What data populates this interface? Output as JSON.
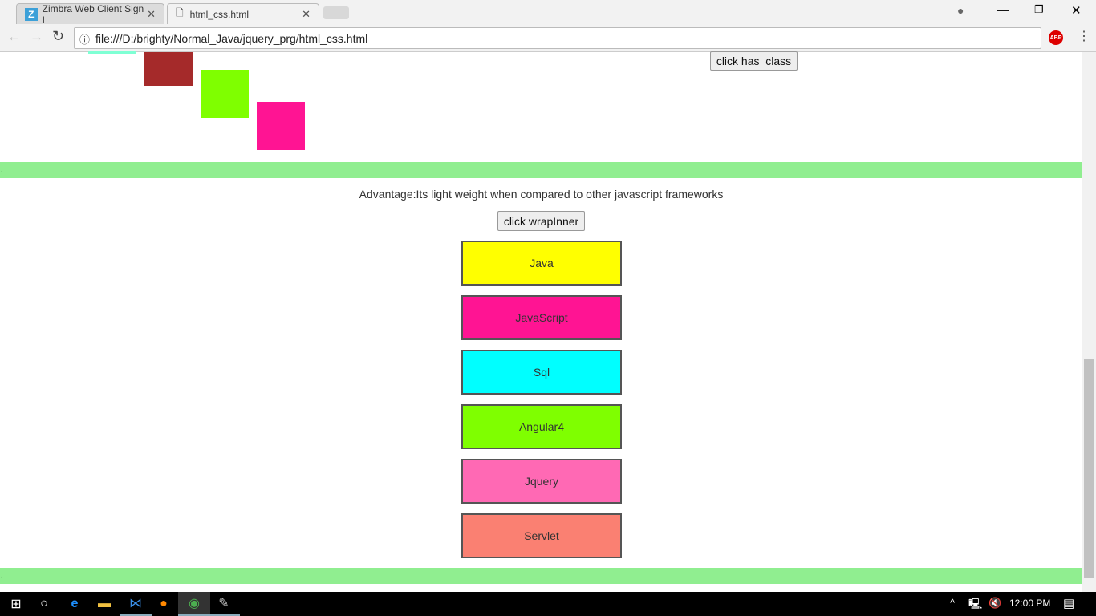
{
  "browser": {
    "tabs": [
      {
        "label": "Zimbra Web Client Sign I",
        "icon": "zimbra-icon",
        "active": false
      },
      {
        "label": "html_css.html",
        "icon": "file-icon",
        "active": true
      }
    ],
    "url": "file:///D:/brighty/Normal_Java/jquery_prg/html_css.html",
    "abp_label": "ABP"
  },
  "page": {
    "squares": [
      {
        "color": "#7fffd4"
      },
      {
        "color": "#a52a2a"
      },
      {
        "color": "#7fff00"
      },
      {
        "color": "#ff1493"
      }
    ],
    "has_class_button": "click has_class",
    "divider_text": ".",
    "advantage_text": "Advantage:Its light weight when compared to other javascript frameworks",
    "wrap_button": "click wrapInner",
    "items": [
      {
        "label": "Java",
        "color": "#ffff00"
      },
      {
        "label": "JavaScript",
        "color": "#ff1493"
      },
      {
        "label": "Sql",
        "color": "#00ffff"
      },
      {
        "label": "Angular4",
        "color": "#7fff00"
      },
      {
        "label": "Jquery",
        "color": "#ff69b4"
      },
      {
        "label": "Servlet",
        "color": "#fa8072"
      }
    ],
    "bar_color": "#90ee90"
  },
  "taskbar": {
    "time": "12:00 PM"
  }
}
